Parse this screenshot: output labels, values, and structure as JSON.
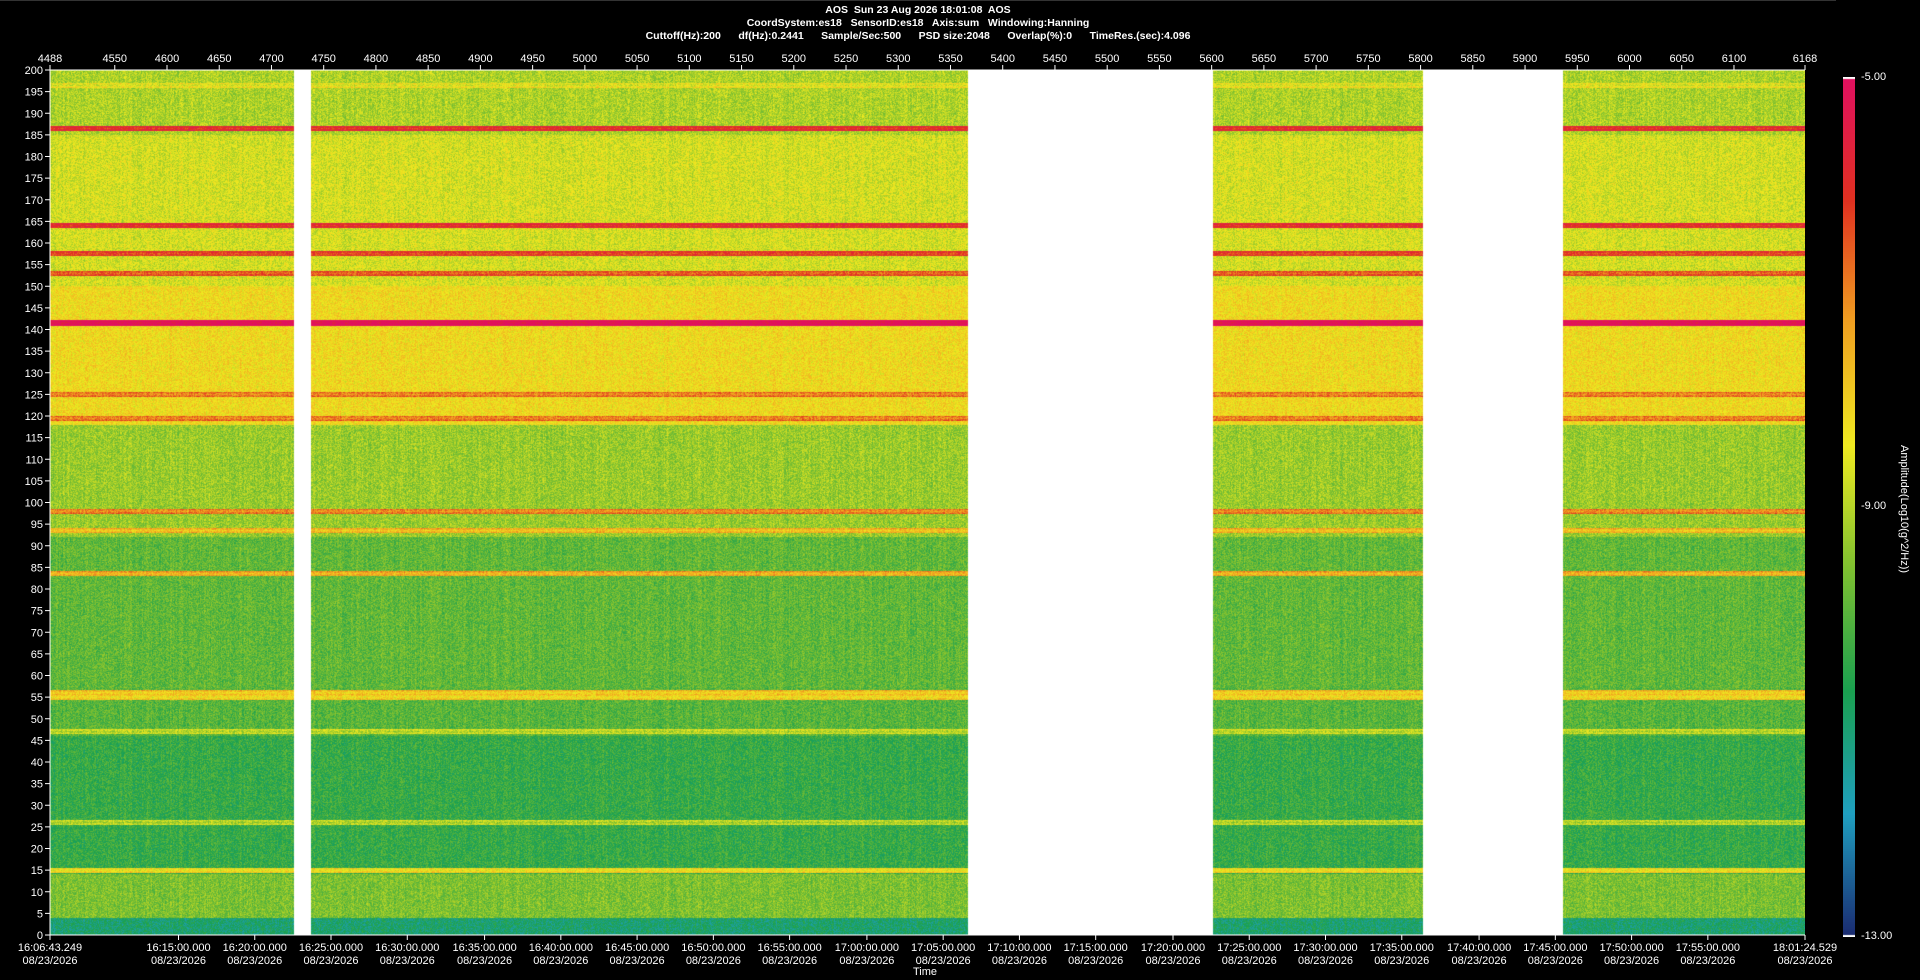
{
  "header": {
    "line1": "AOS  Sun 23 Aug 2026 18:01:08  AOS",
    "line2": "CoordSystem:es18   SensorID:es18   Axis:sum   Windowing:Hanning",
    "line3": "Cuttoff(Hz):200      df(Hz):0.2441      Sample/Sec:500      PSD size:2048      Overlap(%):0      TimeRes.(sec):4.096"
  },
  "colors": {
    "background": "#000000",
    "text": "#ffffff",
    "gaps": "#ffffff",
    "colormap": [
      "#1a2a70",
      "#1f9fc0",
      "#1aa050",
      "#7ec030",
      "#f0ea20",
      "#f0a020",
      "#e03020",
      "#e01060"
    ]
  },
  "chart_data": {
    "type": "heatmap",
    "title": "AOS  Sun 23 Aug 2026 18:01:08  AOS",
    "xlabel": "Time",
    "ylabel": "",
    "colorbar_label": "Amplitude(Log10(g^2/Hz))",
    "colorbar_range": [
      -13.0,
      -5.0
    ],
    "colorbar_ticks": [
      "-5.00",
      "-9.00",
      "-13.00"
    ],
    "ylim": [
      0,
      200
    ],
    "y_ticks": [
      0,
      5,
      10,
      15,
      20,
      25,
      30,
      35,
      40,
      45,
      50,
      55,
      60,
      65,
      70,
      75,
      80,
      85,
      90,
      95,
      100,
      105,
      110,
      115,
      120,
      125,
      130,
      135,
      140,
      145,
      150,
      155,
      160,
      165,
      170,
      175,
      180,
      185,
      190,
      195,
      200
    ],
    "top_index_range": [
      4488,
      6168
    ],
    "top_index_ticks": [
      4488,
      4550,
      4600,
      4650,
      4700,
      4750,
      4800,
      4850,
      4900,
      4950,
      5000,
      5050,
      5100,
      5150,
      5200,
      5250,
      5300,
      5350,
      5400,
      5450,
      5500,
      5550,
      5600,
      5650,
      5700,
      5750,
      5800,
      5850,
      5900,
      5950,
      6000,
      6050,
      6100,
      6168
    ],
    "time_ticks": [
      {
        "index": 4488,
        "time": "16:06:43.249",
        "date": "08/23/2026"
      },
      {
        "index": 4611,
        "time": "16:15:00.000",
        "date": "08/23/2026"
      },
      {
        "index": 4684,
        "time": "16:20:00.000",
        "date": "08/23/2026"
      },
      {
        "index": 4757,
        "time": "16:25:00.000",
        "date": "08/23/2026"
      },
      {
        "index": 4830,
        "time": "16:30:00.000",
        "date": "08/23/2026"
      },
      {
        "index": 4904,
        "time": "16:35:00.000",
        "date": "08/23/2026"
      },
      {
        "index": 4977,
        "time": "16:40:00.000",
        "date": "08/23/2026"
      },
      {
        "index": 5050,
        "time": "16:45:00.000",
        "date": "08/23/2026"
      },
      {
        "index": 5123,
        "time": "16:50:00.000",
        "date": "08/23/2026"
      },
      {
        "index": 5196,
        "time": "16:55:00.000",
        "date": "08/23/2026"
      },
      {
        "index": 5270,
        "time": "17:00:00.000",
        "date": "08/23/2026"
      },
      {
        "index": 5343,
        "time": "17:05:00.000",
        "date": "08/23/2026"
      },
      {
        "index": 5416,
        "time": "17:10:00.000",
        "date": "08/23/2026"
      },
      {
        "index": 5489,
        "time": "17:15:00.000",
        "date": "08/23/2026"
      },
      {
        "index": 5563,
        "time": "17:20:00.000",
        "date": "08/23/2026"
      },
      {
        "index": 5636,
        "time": "17:25:00.000",
        "date": "08/23/2026"
      },
      {
        "index": 5709,
        "time": "17:30:00.000",
        "date": "08/23/2026"
      },
      {
        "index": 5782,
        "time": "17:35:00.000",
        "date": "08/23/2026"
      },
      {
        "index": 5856,
        "time": "17:40:00.000",
        "date": "08/23/2026"
      },
      {
        "index": 5929,
        "time": "17:45:00.000",
        "date": "08/23/2026"
      },
      {
        "index": 6002,
        "time": "17:50:00.000",
        "date": "08/23/2026"
      },
      {
        "index": 6075,
        "time": "17:55:00.000",
        "date": "08/23/2026"
      },
      {
        "index": 6168,
        "time": "18:01:24.529",
        "date": "08/23/2026"
      }
    ],
    "gaps_index": [
      [
        4721,
        4737
      ],
      [
        5366,
        5601
      ],
      [
        5802,
        5936
      ]
    ],
    "spectral_lines": [
      {
        "freq": 141.5,
        "level": -5.3
      },
      {
        "freq": 186.5,
        "level": -6.2
      },
      {
        "freq": 164.0,
        "level": -6.2
      },
      {
        "freq": 157.5,
        "level": -6.5
      },
      {
        "freq": 153.0,
        "level": -6.8
      },
      {
        "freq": 125.0,
        "level": -7.2
      },
      {
        "freq": 119.5,
        "level": -7.2
      },
      {
        "freq": 98.0,
        "level": -7.3
      },
      {
        "freq": 93.5,
        "level": -8.0
      },
      {
        "freq": 83.5,
        "level": -7.8
      },
      {
        "freq": 56.0,
        "level": -8.2
      },
      {
        "freq": 55.0,
        "level": -8.4
      },
      {
        "freq": 47.0,
        "level": -9.2
      },
      {
        "freq": 26.0,
        "level": -9.3
      },
      {
        "freq": 15.0,
        "level": -8.6
      },
      {
        "freq": 196.5,
        "level": -8.8
      }
    ],
    "background_bands": [
      {
        "from": 0,
        "to": 4,
        "level": -11.0
      },
      {
        "from": 4,
        "to": 14,
        "level": -9.6
      },
      {
        "from": 14,
        "to": 46,
        "level": -10.4
      },
      {
        "from": 46,
        "to": 57,
        "level": -10.0
      },
      {
        "from": 57,
        "to": 92,
        "level": -9.9
      },
      {
        "from": 92,
        "to": 118,
        "level": -9.3
      },
      {
        "from": 118,
        "to": 150,
        "level": -8.2
      },
      {
        "from": 150,
        "to": 185,
        "level": -8.7
      },
      {
        "from": 185,
        "to": 200,
        "level": -9.1
      }
    ]
  }
}
